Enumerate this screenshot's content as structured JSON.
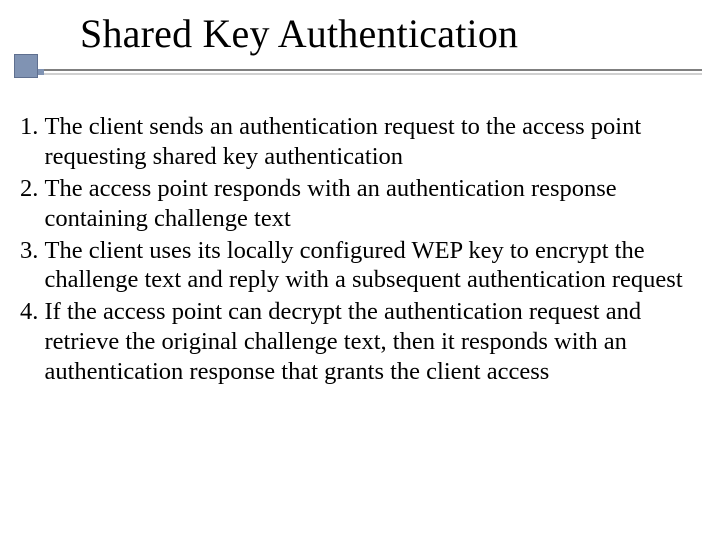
{
  "title": "Shared Key Authentication",
  "items": [
    {
      "n": "1. ",
      "text": "The client sends an authentication request to the access point requesting shared key authentication"
    },
    {
      "n": "2. ",
      "text": "The access point responds with an authentication response containing challenge text"
    },
    {
      "n": "3. ",
      "text": "The client uses its locally configured WEP key to encrypt the challenge text and reply with a subsequent authentication request"
    },
    {
      "n": "4. ",
      "text": "If the access point can decrypt the authentication request and retrieve the original challenge text, then it responds with an authentication response that grants the client access"
    }
  ]
}
